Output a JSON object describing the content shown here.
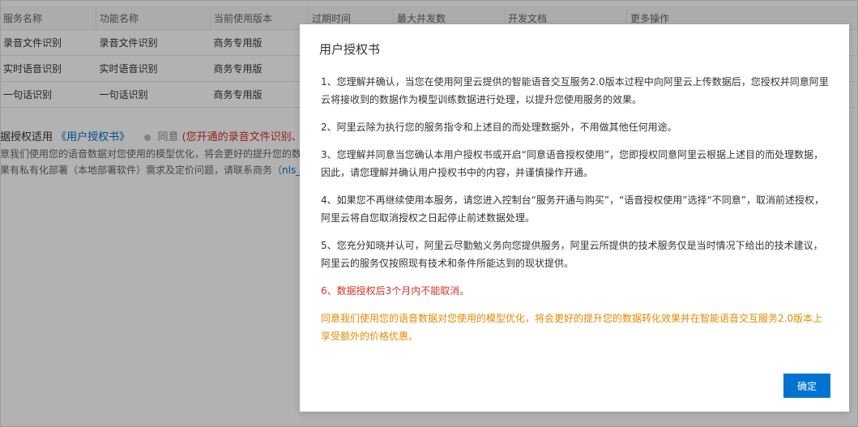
{
  "table": {
    "headers": [
      "服务名称",
      "功能名称",
      "当前使用版本",
      "过期时间",
      "最大并发数",
      "开发文档",
      "更多操作"
    ],
    "rows": [
      [
        "录音文件识别",
        "录音文件识别",
        "商务专用版"
      ],
      [
        "实时语音识别",
        "实时语音识别",
        "商务专用版"
      ],
      [
        "一句话识别",
        "一句话识别",
        "商务专用版"
      ]
    ]
  },
  "auth": {
    "label": "据授权适用",
    "link": "《用户授权书》",
    "agree": "同意",
    "notice": "(您开通的录音文件识别、实"
  },
  "background": {
    "desc1": "意我们使用您的语音数据对您使用的模型优化，将会更好的提升您的数",
    "desc2": "果有私有化部署（本地部署软件）需求及定价问题，请联系商务（",
    "desc2_code": "nls_s"
  },
  "modal": {
    "title": "用户授权书",
    "paragraphs": [
      "1、您理解并确认，当您在使用阿里云提供的智能语音交互服务2.0版本过程中向阿里云上传数据后，您授权并同意阿里云将接收到的数据作为模型训练数据进行处理，以提升您使用服务的效果。",
      "2、阿里云除为执行您的服务指令和上述目的而处理数据外，不用做其他任何用途。",
      "3、您理解并同意当您确认本用户授权书或开启“同意语音授权使用”，您即授权同意阿里云根据上述目的而处理数据，因此，请您理解并确认用户授权书中的内容，并谨慎操作开通。",
      "4、如果您不再继续使用本服务，请您进入控制台“服务开通与购买”，“语音授权使用”选择“不同意”，取消前述授权，阿里云将自您取消授权之日起停止前述数据处理。",
      "5、您充分知晓并认可，阿里云尽勤勉义务向您提供服务，阿里云所提供的技术服务仅是当时情况下给出的技术建议，阿里云的服务仅按照现有技术和条件所能达到的现状提供。"
    ],
    "warning": "6、数据授权后3个月内不能取消。",
    "highlight": "同意我们使用您的语音数据对您使用的模型优化，将会更好的提升您的数据转化效果并在智能语音交互服务2.0版本上享受额外的价格优惠。",
    "ok_label": "确定"
  }
}
